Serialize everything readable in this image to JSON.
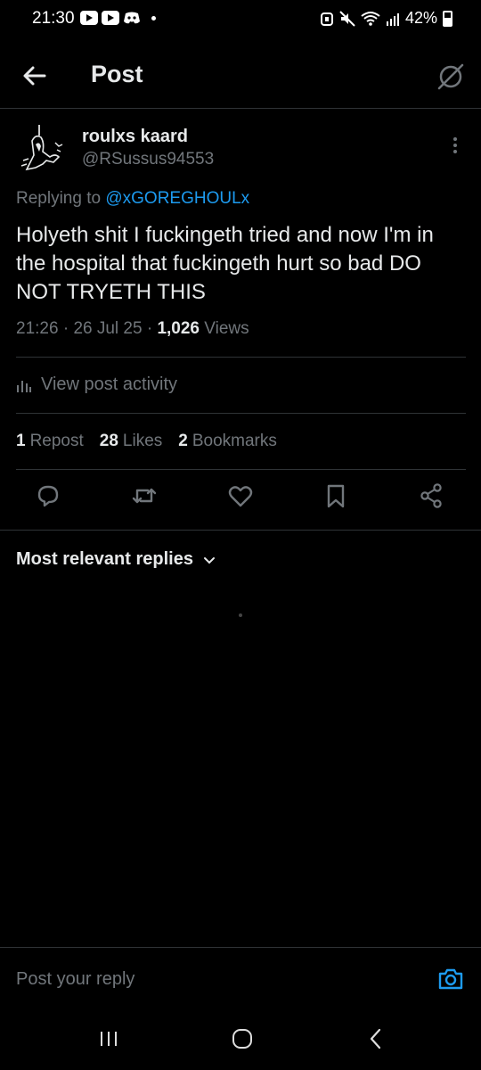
{
  "status_bar": {
    "time": "21:30",
    "battery": "42%",
    "app_icons": [
      "youtube-icon",
      "youtube-icon",
      "discord-icon"
    ]
  },
  "header": {
    "title": "Post"
  },
  "post": {
    "author_name": "roulxs kaard",
    "author_handle": "@RSussus94553",
    "replying_prefix": "Replying to ",
    "replying_to": "@xGOREGHOULx",
    "text": "Holyeth shit I fuckingeth tried and now I'm in the hospital that fuckingeth hurt so bad DO NOT TRYETH THIS",
    "time": "21:26",
    "date": "26 Jul 25",
    "views_count": "1,026",
    "views_label": "Views",
    "separator": " · "
  },
  "activity": {
    "label": "View post activity"
  },
  "stats": {
    "reposts_count": "1",
    "reposts_label": "Repost",
    "likes_count": "28",
    "likes_label": "Likes",
    "bookmarks_count": "2",
    "bookmarks_label": "Bookmarks"
  },
  "replies": {
    "sort_label": "Most relevant replies"
  },
  "reply_bar": {
    "placeholder": "Post your reply"
  },
  "colors": {
    "background": "#000000",
    "text": "#e7e9ea",
    "muted": "#71767b",
    "accent": "#1d9bf0",
    "divider": "#2f3336"
  }
}
